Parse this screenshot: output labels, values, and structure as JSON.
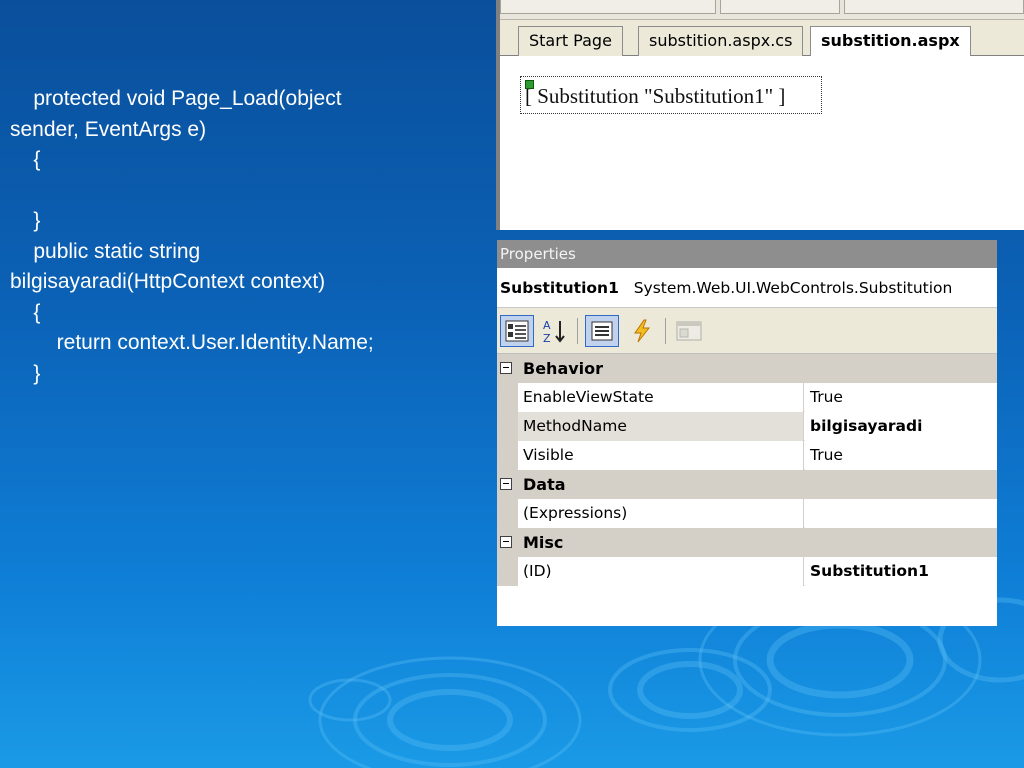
{
  "code": {
    "lines": [
      "    protected void Page_Load(object",
      "sender, EventArgs e)",
      "    {",
      "",
      "    }",
      "    public static string",
      "bilgisayaradi(HttpContext context)",
      "    {",
      "        return context.User.Identity.Name;",
      "    }"
    ]
  },
  "designer": {
    "tabs": [
      {
        "label": "Start Page"
      },
      {
        "label": "substition.aspx.cs"
      },
      {
        "label": "substition.aspx"
      }
    ],
    "control_text": "[ Substitution \"Substitution1\" ]"
  },
  "properties": {
    "title": "Properties",
    "object_name": "Substitution1",
    "object_type": "System.Web.UI.WebControls.Substitution",
    "toolbar_icons": [
      "categorized-icon",
      "alphabetical-icon",
      "properties-icon",
      "events-icon",
      "property-pages-icon"
    ],
    "categories": [
      {
        "name": "Behavior",
        "rows": [
          {
            "name": "EnableViewState",
            "value": "True"
          },
          {
            "name": "MethodName",
            "value": "bilgisayaradi"
          },
          {
            "name": "Visible",
            "value": "True"
          }
        ]
      },
      {
        "name": "Data",
        "rows": [
          {
            "name": "(Expressions)",
            "value": ""
          }
        ]
      },
      {
        "name": "Misc",
        "rows": [
          {
            "name": "(ID)",
            "value": "Substitution1"
          }
        ]
      }
    ]
  },
  "colors": {
    "background_top": "#0a4f9c",
    "background_bottom": "#1a9ae6",
    "category_row": "#d4d0c8",
    "titlebar": "#8e8e8e"
  }
}
